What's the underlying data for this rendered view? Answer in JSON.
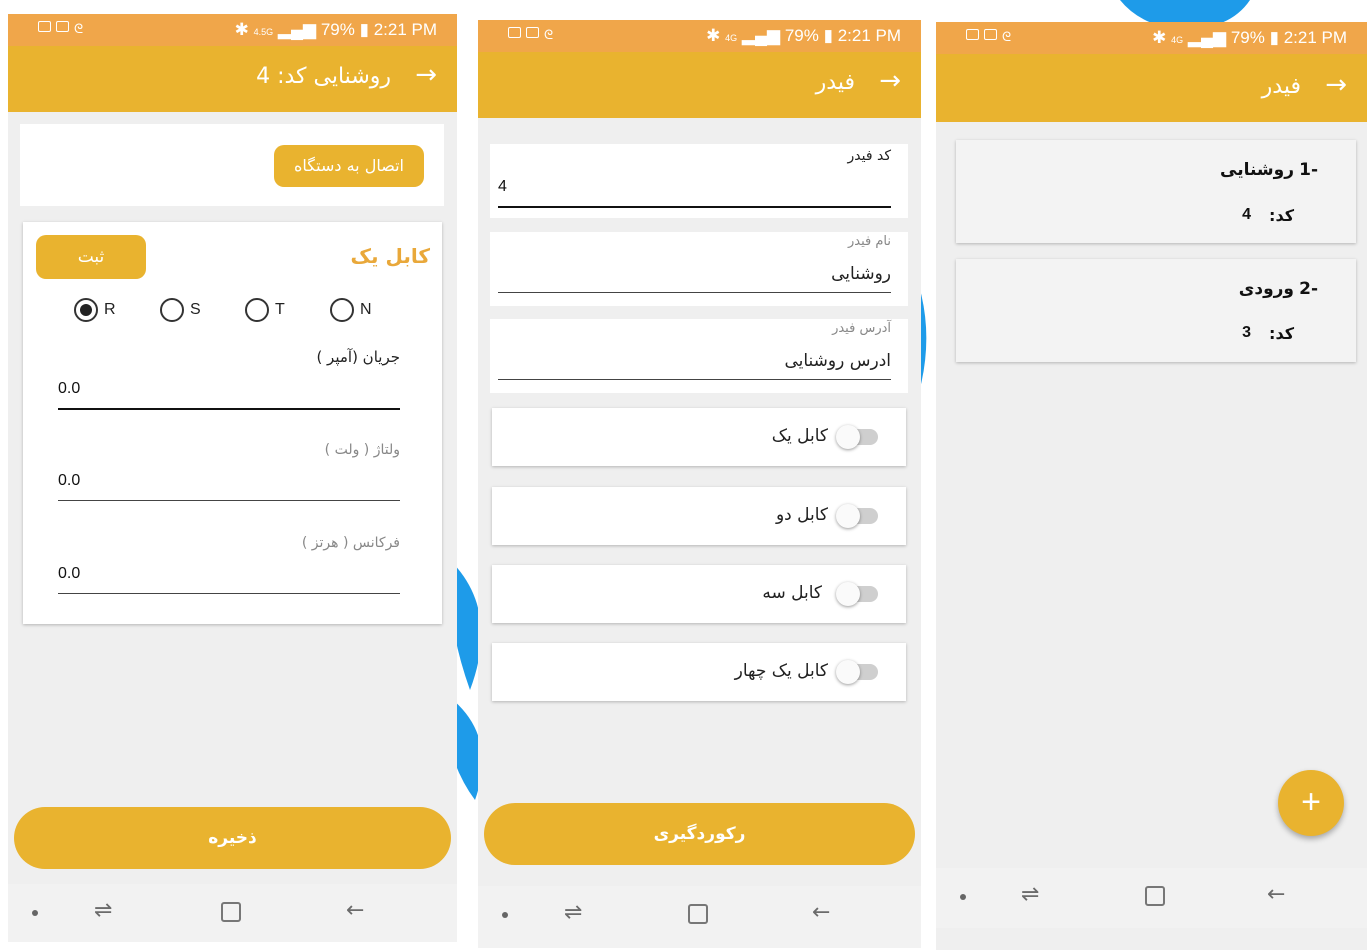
{
  "status_bar": {
    "battery": "79%",
    "time": "2:21 PM",
    "network_a": "4.5G",
    "network_b": "4G"
  },
  "screen1": {
    "appbar": {
      "title": "روشنایی  کد: 4"
    },
    "connect_button": "اتصال به دستگاه",
    "cable_card": {
      "title": "کابل یک",
      "submit_button": "ثبت",
      "phases": [
        {
          "label": "R",
          "selected": true
        },
        {
          "label": "S",
          "selected": false
        },
        {
          "label": "T",
          "selected": false
        },
        {
          "label": "N",
          "selected": false
        }
      ],
      "current_label": "جریان (آمپر )",
      "current_value": "0.0",
      "voltage_label": "ولتاژ ( ولت )",
      "voltage_value": "0.0",
      "frequency_label": "فرکانس ( هرتز )",
      "frequency_value": "0.0"
    },
    "save_button": "ذخیره"
  },
  "screen2": {
    "appbar": {
      "title": "فیدر"
    },
    "feeder_code_label": "کد فیدر",
    "feeder_code_value": "4",
    "feeder_name_label": "نام فیدر",
    "feeder_name_value": "روشنایی",
    "feeder_address_label": "آدرس فیدر",
    "feeder_address_value": "ادرس روشنایی",
    "cables": [
      {
        "label": "کابل یک",
        "on": false
      },
      {
        "label": "کابل دو",
        "on": false
      },
      {
        "label": "کابل سه",
        "on": false
      },
      {
        "label": "کابل یک چهار",
        "on": false
      }
    ],
    "record_button": "رکوردگیری"
  },
  "screen3": {
    "appbar": {
      "title": "فیدر"
    },
    "items": [
      {
        "index": "-1",
        "name": "روشنایی",
        "code_label": "کد:",
        "code": "4"
      },
      {
        "index": "-2",
        "name": "ورودی",
        "code_label": "کد:",
        "code": "3"
      }
    ],
    "fab_label": "+"
  },
  "colors": {
    "accent": "#e9b32f",
    "status_bar": "#f0a64a",
    "background": "#efefef",
    "decoration": "#1e9be9"
  },
  "icons": [
    "image-icon",
    "mail-icon",
    "bluetooth-icon",
    "signal-icon",
    "battery-icon",
    "arrow-right-icon",
    "home-icon",
    "recents-icon",
    "back-icon",
    "plus-icon"
  ]
}
